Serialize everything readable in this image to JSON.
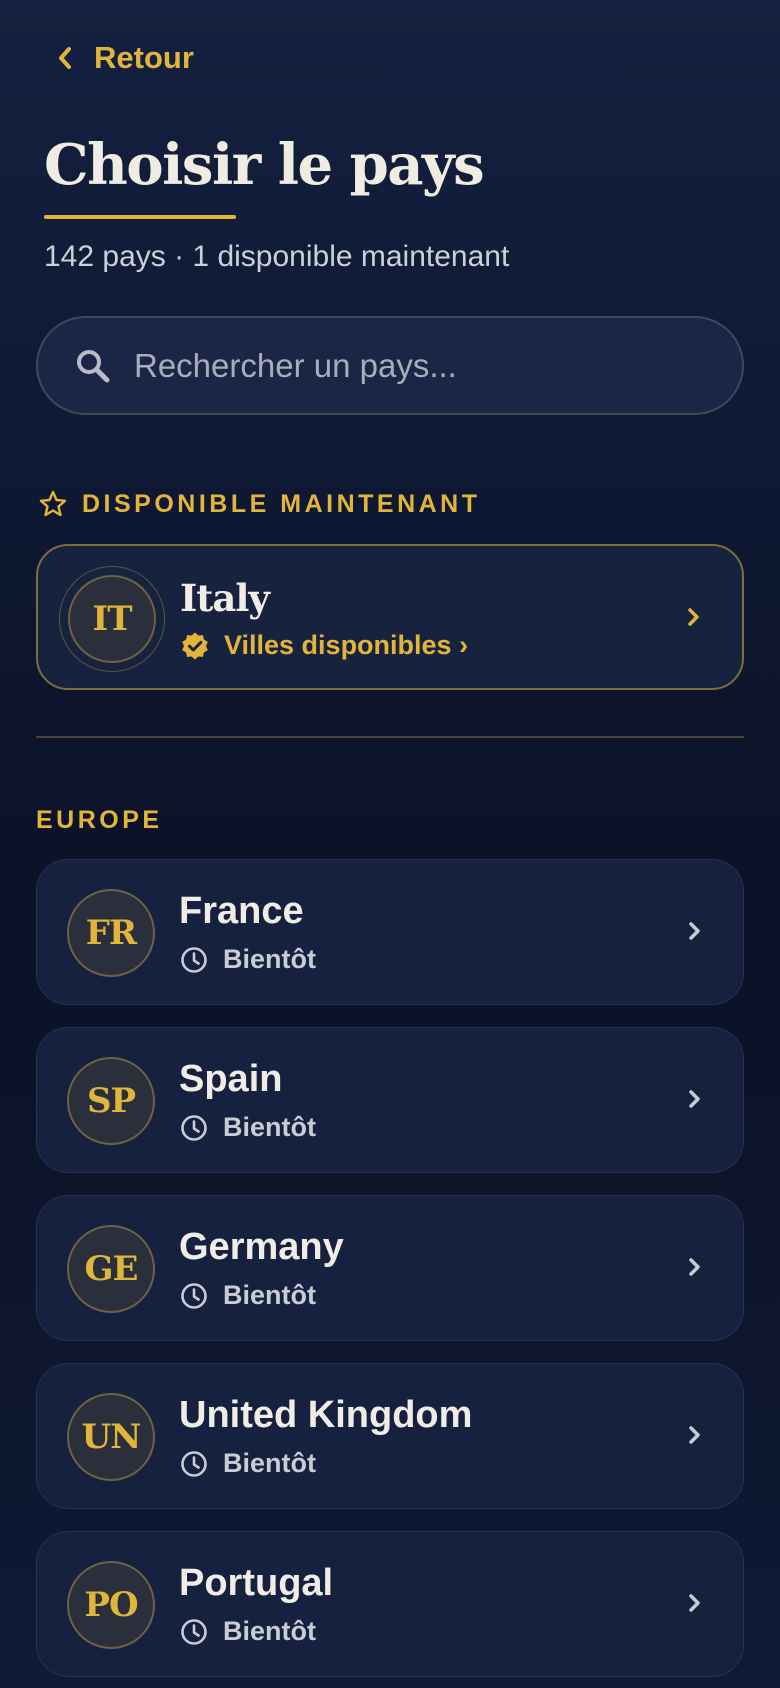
{
  "header": {
    "back_label": "Retour",
    "title": "Choisir le pays",
    "subtitle": "142 pays · 1 disponible maintenant"
  },
  "search": {
    "placeholder": "Rechercher un pays..."
  },
  "colors": {
    "accent": "#e2b53a",
    "background": "#0e1730",
    "card": "#15213f",
    "text": "#ece7de"
  },
  "available_section": {
    "heading": "DISPONIBLE MAINTENANT",
    "icon": "star-icon",
    "countries": [
      {
        "code": "IT",
        "name": "Italy",
        "status": "Villes disponibles ›",
        "status_icon": "verified-badge-icon"
      }
    ]
  },
  "europe_section": {
    "heading": "EUROPE",
    "countries": [
      {
        "code": "FR",
        "name": "France",
        "status": "Bientôt",
        "status_icon": "clock-icon"
      },
      {
        "code": "SP",
        "name": "Spain",
        "status": "Bientôt",
        "status_icon": "clock-icon"
      },
      {
        "code": "GE",
        "name": "Germany",
        "status": "Bientôt",
        "status_icon": "clock-icon"
      },
      {
        "code": "UN",
        "name": "United Kingdom",
        "status": "Bientôt",
        "status_icon": "clock-icon"
      },
      {
        "code": "PO",
        "name": "Portugal",
        "status": "Bientôt",
        "status_icon": "clock-icon"
      }
    ]
  }
}
